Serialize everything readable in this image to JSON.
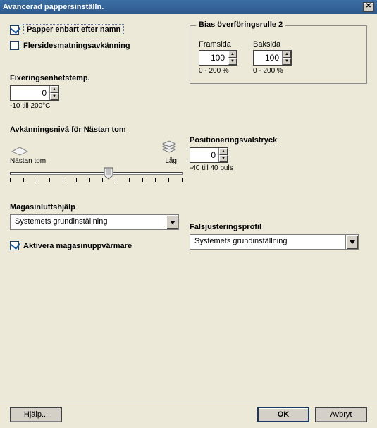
{
  "window": {
    "title": "Avancerad pappersinställn.",
    "close_glyph": "✕"
  },
  "checkboxes": {
    "paper_by_name": {
      "label": "Papper enbart efter namn",
      "checked": true
    },
    "multi_feed": {
      "label": "Flersidesmatningsavkänning",
      "checked": false
    }
  },
  "bias": {
    "title": "Bias överföringsrulle 2",
    "front_label": "Framsida",
    "front_value": "100",
    "back_label": "Baksida",
    "back_value": "100",
    "range_hint": "0 - 200 %"
  },
  "fuser": {
    "label": "Fixeringsenhetstemp.",
    "value": "0",
    "hint": "-10 till 200°C"
  },
  "sensing": {
    "label": "Avkänningsnivå för Nästan tom",
    "low_icon_label": "Nästan tom",
    "high_icon_label": "Låg",
    "slider_position_pct": 55,
    "tick_count": 14
  },
  "positioning": {
    "label": "Positioneringsvalstryck",
    "value": "0",
    "hint": "-40 till 40 puls"
  },
  "tray_air": {
    "label": "Magasinluftshjälp",
    "selected": "Systemets grundinställning"
  },
  "fold_profile": {
    "label": "Falsjusteringsprofil",
    "selected": "Systemets grundinställning"
  },
  "tray_heater": {
    "label": "Aktivera magasinuppvärmare",
    "checked": true
  },
  "footer": {
    "help": "Hjälp...",
    "ok": "OK",
    "cancel": "Avbryt"
  }
}
